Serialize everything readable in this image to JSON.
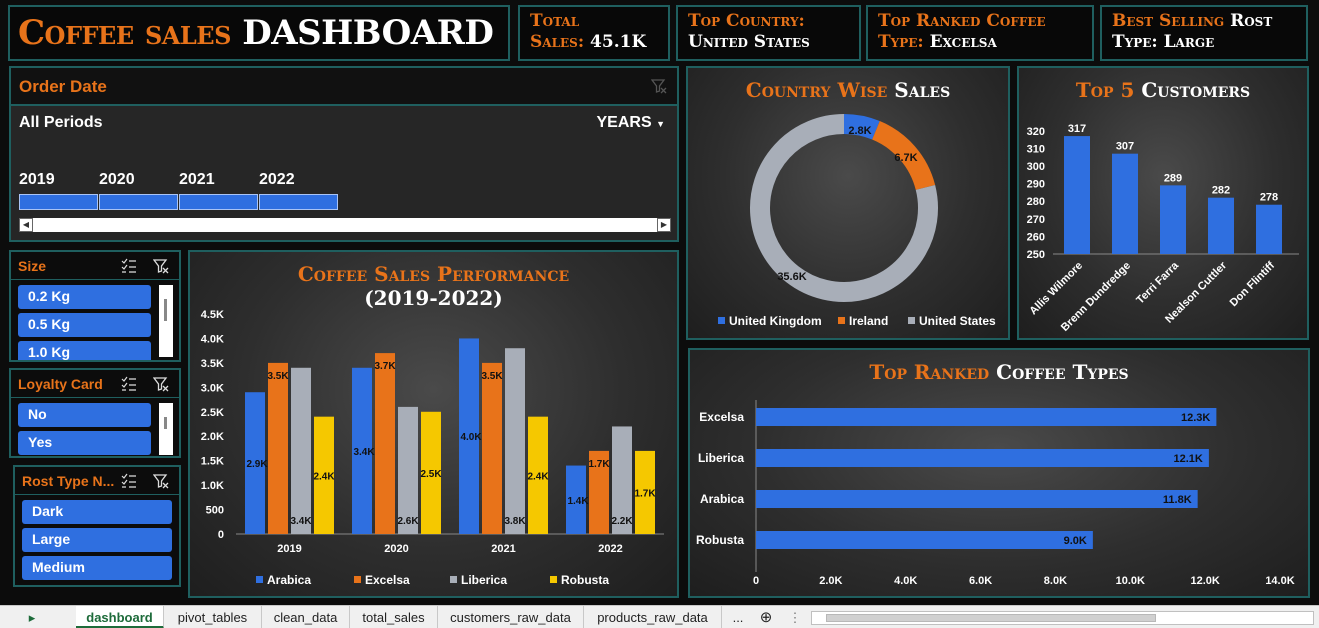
{
  "header": {
    "title_part1": "Coffee sales",
    "title_part2": "DASHBOARD",
    "kpis": [
      {
        "label": "Total",
        "label2": "Sales:",
        "value": "45.1K"
      },
      {
        "label": "Top Country:",
        "value": "United States"
      },
      {
        "label": "Top Ranked Coffee",
        "label2": "Type:",
        "value": "Excelsa"
      },
      {
        "label": "Best Selling",
        "label_white": "Rost",
        "label2": "Type:",
        "value": "Large"
      }
    ]
  },
  "timeline": {
    "title": "Order Date",
    "periods_label": "All Periods",
    "level_label": "YEARS",
    "years": [
      "2019",
      "2020",
      "2021",
      "2022"
    ]
  },
  "slicers": {
    "size": {
      "title": "Size",
      "items": [
        "0.2 Kg",
        "0.5 Kg",
        "1.0 Kg"
      ]
    },
    "loyalty": {
      "title": "Loyalty Card",
      "items": [
        "No",
        "Yes"
      ]
    },
    "rost": {
      "title": "Rost Type N...",
      "items": [
        "Dark",
        "Large",
        "Medium"
      ]
    }
  },
  "charts": {
    "performance": {
      "title_line1": "Coffee Sales Performance",
      "title_line2": "(2019-2022)"
    },
    "country": {
      "title_part1": "Country Wise",
      "title_part2": "Sales"
    },
    "customers": {
      "title_part1": "Top 5",
      "title_part2": "Customers"
    },
    "types": {
      "title_part1": "Top Ranked",
      "title_part2": "Coffee Types"
    }
  },
  "colors": {
    "orange": "#e8731a",
    "blue": "#2f6fe0",
    "grey": "#a8aeb8",
    "yellow": "#f5c800",
    "teal_border": "#1f5f5f"
  },
  "chart_data": [
    {
      "type": "bar",
      "title": "Coffee Sales Performance (2019-2022)",
      "categories": [
        "2019",
        "2020",
        "2021",
        "2022"
      ],
      "series": [
        {
          "name": "Arabica",
          "values": [
            2.9,
            3.4,
            4.0,
            1.4
          ],
          "labels": [
            "2.9K",
            "3.4K",
            "4.0K",
            "1.4K"
          ]
        },
        {
          "name": "Excelsa",
          "values": [
            3.5,
            3.7,
            3.5,
            1.7
          ],
          "labels": [
            "3.5K",
            "3.7K",
            "3.5K",
            "1.7K"
          ]
        },
        {
          "name": "Liberica",
          "values": [
            3.4,
            2.6,
            3.8,
            2.2
          ],
          "labels": [
            "3.4K",
            "2.6K",
            "3.8K",
            "2.2K"
          ]
        },
        {
          "name": "Robusta",
          "values": [
            2.4,
            2.5,
            2.4,
            1.7
          ],
          "labels": [
            "2.4K",
            "2.5K",
            "2.4K",
            "1.7K"
          ]
        }
      ],
      "yticks": [
        "0",
        "500",
        "1.0K",
        "1.5K",
        "2.0K",
        "2.5K",
        "3.0K",
        "3.5K",
        "4.0K",
        "4.5K"
      ],
      "ylim": [
        0,
        4.5
      ],
      "legend": "bottom"
    },
    {
      "type": "pie",
      "title": "Country Wise Sales",
      "labels": [
        "United Kingdom",
        "Ireland",
        "United States"
      ],
      "values": [
        2.8,
        6.7,
        35.6
      ],
      "value_labels": [
        "2.8K",
        "6.7K",
        "35.6K"
      ],
      "legend": "bottom"
    },
    {
      "type": "bar",
      "title": "Top 5 Customers",
      "categories": [
        "Allis Wilmore",
        "Brenn Dundredge",
        "Terri Farra",
        "Nealson Cuttler",
        "Don Flintiff"
      ],
      "values": [
        317,
        307,
        289,
        282,
        278
      ],
      "yticks": [
        "250",
        "260",
        "270",
        "280",
        "290",
        "300",
        "310",
        "320"
      ],
      "ylim": [
        250,
        325
      ]
    },
    {
      "type": "bar",
      "orientation": "horizontal",
      "title": "Top Ranked Coffee Types",
      "categories": [
        "Excelsa",
        "Liberica",
        "Arabica",
        "Robusta"
      ],
      "values": [
        12.3,
        12.1,
        11.8,
        9.0
      ],
      "value_labels": [
        "12.3K",
        "12.1K",
        "11.8K",
        "9.0K"
      ],
      "xticks": [
        "0",
        "2.0K",
        "4.0K",
        "6.0K",
        "8.0K",
        "10.0K",
        "12.0K",
        "14.0K"
      ],
      "xlim": [
        0,
        14
      ]
    }
  ],
  "tabs": {
    "items": [
      "dashboard",
      "pivot_tables",
      "clean_data",
      "total_sales",
      "customers_raw_data",
      "products_raw_data",
      "..."
    ],
    "active": "dashboard"
  }
}
